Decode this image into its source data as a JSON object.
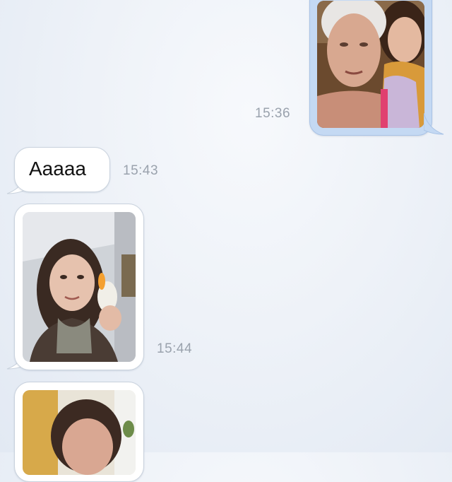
{
  "messages": [
    {
      "direction": "outgoing",
      "type": "photo",
      "time": "15:36"
    },
    {
      "direction": "incoming",
      "type": "text",
      "text": "Aaaaa",
      "time": "15:43"
    },
    {
      "direction": "incoming",
      "type": "photo",
      "time": "15:44"
    },
    {
      "direction": "incoming",
      "type": "photo",
      "time": ""
    }
  ],
  "colors": {
    "background": "#eef2f8",
    "outgoing_bubble": "#c4d9f3",
    "incoming_bubble": "#ffffff",
    "timestamp": "#9aa2ad"
  }
}
